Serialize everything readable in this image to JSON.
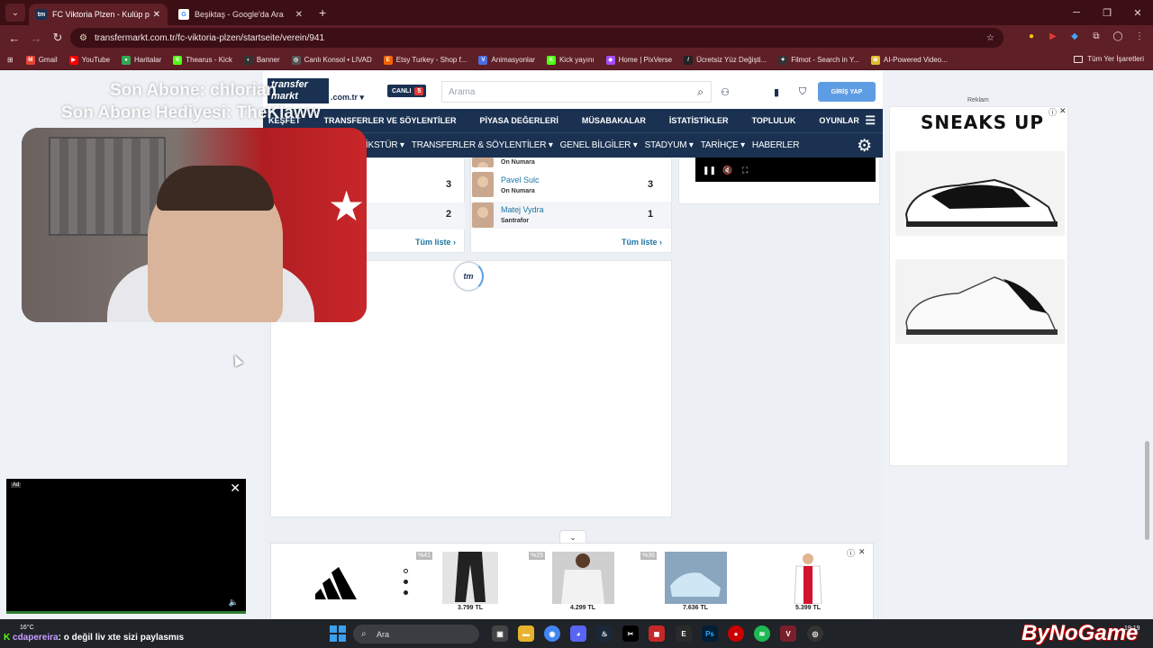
{
  "browser": {
    "tabs": [
      {
        "label": "FC Viktoria Plzen - Kulüp profili",
        "favicon": "tm",
        "active": true
      },
      {
        "label": "Beşiktaş - Google'da Ara",
        "favicon": "G",
        "active": false
      }
    ],
    "url": "transfermarkt.com.tr/fc-viktoria-plzen/startseite/verein/941",
    "bookmarks": [
      {
        "label": "Gmail",
        "color": "#ea4335",
        "icon": "M"
      },
      {
        "label": "YouTube",
        "color": "#ff0000",
        "icon": "▶"
      },
      {
        "label": "Haritalar",
        "color": "#34a853",
        "icon": "●"
      },
      {
        "label": "Thearus - Kick",
        "color": "#53fc18",
        "icon": "K"
      },
      {
        "label": "Banner",
        "color": "#333",
        "icon": "◐"
      },
      {
        "label": "Canlı Konsol • LIVAD",
        "color": "#555",
        "icon": "◎"
      },
      {
        "label": "Etsy Turkey - Shop f...",
        "color": "#f56400",
        "icon": "E"
      },
      {
        "label": "Animasyonlar",
        "color": "#4a6ee0",
        "icon": "V"
      },
      {
        "label": "Kick yayını",
        "color": "#53fc18",
        "icon": "K"
      },
      {
        "label": "Home | PixVerse",
        "color": "#a64dff",
        "icon": "◆"
      },
      {
        "label": "Ücretsiz Yüz Değişti...",
        "color": "#222",
        "icon": "/"
      },
      {
        "label": "Filmot - Search in Y...",
        "color": "#333",
        "icon": "✦"
      },
      {
        "label": "AI-Powered Video...",
        "color": "#e0c030",
        "icon": "✿"
      }
    ],
    "all_bookmarks_label": "Tüm Yer İşaretleri"
  },
  "tm": {
    "logo": "transfer markt",
    "domain": ".com.tr ▾",
    "live_label": "CANLI",
    "live_count": "5",
    "search_placeholder": "Arama",
    "login": "GİRİŞ YAP",
    "nav1": [
      "KEŞFET",
      "TRANSFERLER VE SÖYLENTİLER",
      "PİYASA DEĞERLERİ",
      "MÜSABAKALAR",
      "İSTATİSTİKLER",
      "TOPLULUK",
      "OYUNLAR"
    ],
    "nav2": [
      "FİKSTÜR ▾",
      "TRANSFERLER & SÖYLENTİLER ▾",
      "GENEL BİLGİLER ▾",
      "STADYUM ▾",
      "TARİHÇE ▾",
      "HABERLER"
    ],
    "left_list": {
      "values": [
        "3",
        "2"
      ],
      "more": "Tüm liste ›"
    },
    "right_list": {
      "top_role": "On Numara",
      "players": [
        {
          "name": "Pavel Sulc",
          "role": "On Numara",
          "value": "3"
        },
        {
          "name": "Matej Vydra",
          "role": "Santrafor",
          "value": "1"
        }
      ],
      "more": "Tüm liste ›"
    },
    "spinner": "tm"
  },
  "ads": {
    "reklam": "Reklam",
    "brand": "SNEAKS UP",
    "bottom_products": [
      {
        "discount": "%41",
        "price": "3.799 TL"
      },
      {
        "discount": "%25",
        "price": "4.299 TL"
      },
      {
        "discount": "%36",
        "price": "7.636 TL"
      },
      {
        "discount": "",
        "price": "5.399 TL"
      }
    ]
  },
  "stream": {
    "last_sub": "Son Abone: chlorian",
    "last_gift": "Son Abone Hediyesi: TheKlaww",
    "chat_user": "cdapereira",
    "chat_text": ": o değil liv xte sizi paylasmıs",
    "weather": "16°C",
    "brand": "ByNoGame",
    "ad_label": "Ad"
  },
  "taskbar": {
    "search": "Ara",
    "clock": "19:19"
  }
}
